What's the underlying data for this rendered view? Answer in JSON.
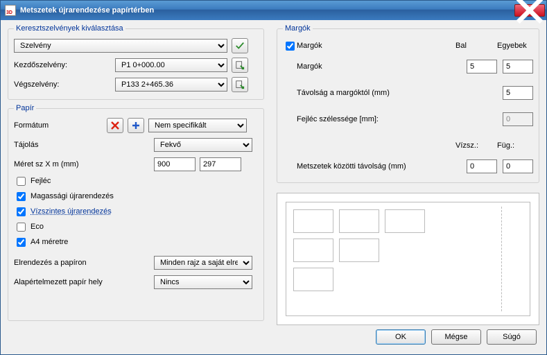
{
  "window": {
    "title": "Metszetek újrarendezése papírtérben"
  },
  "cross": {
    "legend": "Keresztszelvények kiválasztása",
    "select_value": "Szelvény",
    "start_label": "Kezdőszelvény:",
    "start_value": "P1 0+000.00",
    "end_label": "Végszelvény:",
    "end_value": "P133 2+465.36"
  },
  "paper": {
    "legend": "Papír",
    "format_label": "Formátum",
    "format_value": "Nem specifikált",
    "orient_label": "Tájolás",
    "orient_value": "Fekvő",
    "size_label": "Méret sz X m (mm)",
    "size_w": "900",
    "size_h": "297",
    "header_label": "Fejléc",
    "height_reorder_label": "Magassági újrarendezés",
    "horiz_reorder_label": "Vízszintes újrarendezés",
    "eco_label": "Eco",
    "a4_label": "A4 méretre",
    "layout_label": "Elrendezés a papíron",
    "layout_value": "Minden rajz a saját elrendezésben",
    "default_label": "Alapértelmezett papír hely",
    "default_value": "Nincs",
    "chk": {
      "header": false,
      "height": true,
      "horiz": true,
      "eco": false,
      "a4": true
    }
  },
  "margins": {
    "legend": "Margók",
    "enable_label": "Margók",
    "enable": true,
    "col_left": "Bal",
    "col_others": "Egyebek",
    "row_margins": "Margók",
    "val_left": "5",
    "val_others": "5",
    "dist_label": "Távolság a margóktól (mm)",
    "dist_val": "5",
    "header_w_label": "Fejléc szélessége [mm]:",
    "header_w_val": "0",
    "between_label": "Metszetek közötti távolság (mm)",
    "col_h": "Vízsz.:",
    "col_v": "Füg.:",
    "between_h": "0",
    "between_v": "0"
  },
  "footer": {
    "ok": "OK",
    "cancel": "Mégse",
    "help": "Súgó"
  }
}
